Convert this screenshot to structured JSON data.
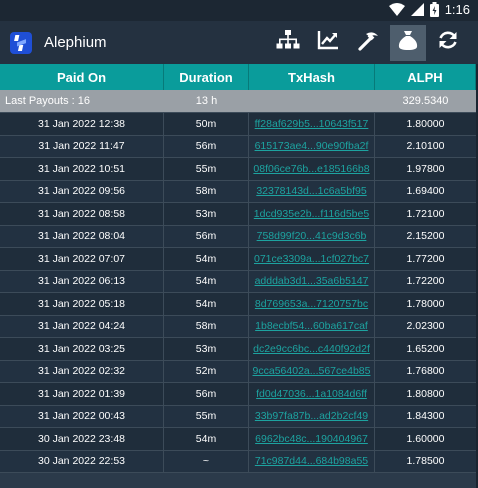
{
  "status_bar": {
    "time": "1:16"
  },
  "app": {
    "title": "Alephium"
  },
  "toolbar": {
    "icons": [
      "network-icon",
      "chart-icon",
      "pickaxe-icon",
      "money-bag-icon",
      "refresh-icon"
    ],
    "active": "money-bag-icon"
  },
  "table": {
    "headers": {
      "paid_on": "Paid On",
      "duration": "Duration",
      "txhash": "TxHash",
      "alph": "ALPH"
    },
    "summary": {
      "label": "Last Payouts : 16",
      "duration": "13 h",
      "total": "329.5340"
    },
    "rows": [
      {
        "paid_on": "31 Jan 2022 12:38",
        "duration": "50m",
        "txhash": "ff28af629b5...10643f517",
        "alph": "1.80000"
      },
      {
        "paid_on": "31 Jan 2022 11:47",
        "duration": "56m",
        "txhash": "615173ae4...90e90fba2f",
        "alph": "2.10100"
      },
      {
        "paid_on": "31 Jan 2022 10:51",
        "duration": "55m",
        "txhash": "08f06ce76b...e185166b8",
        "alph": "1.97800"
      },
      {
        "paid_on": "31 Jan 2022 09:56",
        "duration": "58m",
        "txhash": "32378143d...1c6a5bf95",
        "alph": "1.69400"
      },
      {
        "paid_on": "31 Jan 2022 08:58",
        "duration": "53m",
        "txhash": "1dcd935e2b...f116d5be5",
        "alph": "1.72100"
      },
      {
        "paid_on": "31 Jan 2022 08:04",
        "duration": "56m",
        "txhash": "758d99f20...41c9d3c6b",
        "alph": "2.15200"
      },
      {
        "paid_on": "31 Jan 2022 07:07",
        "duration": "54m",
        "txhash": "071ce3309a...1cf027bc7",
        "alph": "1.77200"
      },
      {
        "paid_on": "31 Jan 2022 06:13",
        "duration": "54m",
        "txhash": "adddab3d1...35a6b5147",
        "alph": "1.72200"
      },
      {
        "paid_on": "31 Jan 2022 05:18",
        "duration": "54m",
        "txhash": "8d769653a...7120757bc",
        "alph": "1.78000"
      },
      {
        "paid_on": "31 Jan 2022 04:24",
        "duration": "58m",
        "txhash": "1b8ecbf54...60ba617caf",
        "alph": "2.02300"
      },
      {
        "paid_on": "31 Jan 2022 03:25",
        "duration": "53m",
        "txhash": "dc2e9cc6bc...c440f92d2f",
        "alph": "1.65200"
      },
      {
        "paid_on": "31 Jan 2022 02:32",
        "duration": "52m",
        "txhash": "9cca56402a...567ce4b85",
        "alph": "1.76800"
      },
      {
        "paid_on": "31 Jan 2022 01:39",
        "duration": "56m",
        "txhash": "fd0d47036...1a1084d6ff",
        "alph": "1.80800"
      },
      {
        "paid_on": "31 Jan 2022 00:43",
        "duration": "55m",
        "txhash": "33b97fa87b...ad2b2cf49",
        "alph": "1.84300"
      },
      {
        "paid_on": "30 Jan 2022 23:48",
        "duration": "54m",
        "txhash": "6962bc48c...190404967",
        "alph": "1.60000"
      },
      {
        "paid_on": "30 Jan 2022 22:53",
        "duration": "~",
        "txhash": "71c987d44...684b98a55",
        "alph": "1.78500"
      }
    ]
  },
  "colors": {
    "header_bg": "#0a9c9b",
    "appbar_bg": "#243140",
    "link": "#1da3a0",
    "summary_bg": "#9aa0a6"
  }
}
